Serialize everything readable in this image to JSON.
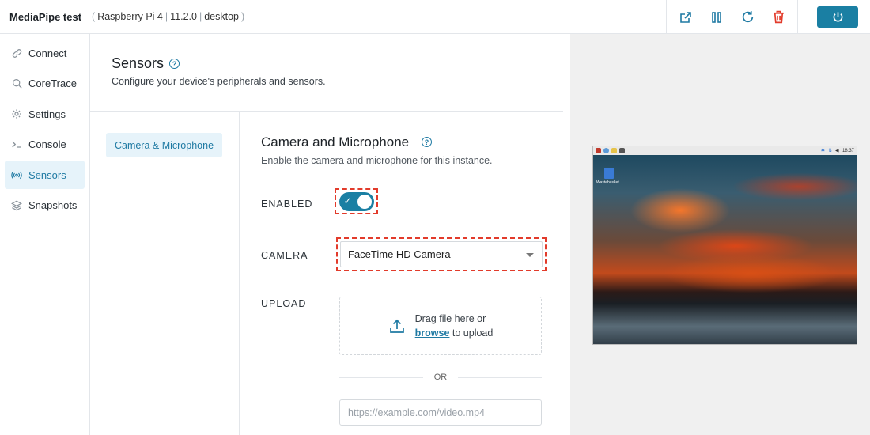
{
  "header": {
    "app_title": "MediaPipe test",
    "device": "Raspberry Pi 4",
    "version": "11.2.0",
    "mode": "desktop"
  },
  "toolbar": {
    "icons": [
      "open-external-icon",
      "pause-icon",
      "refresh-icon",
      "trash-icon"
    ],
    "power_icon": "power-icon",
    "accent": "#1a7fa3",
    "danger": "#e23b2b"
  },
  "sidebar": {
    "items": [
      {
        "label": "Connect",
        "icon": "link-icon"
      },
      {
        "label": "CoreTrace",
        "icon": "search-icon"
      },
      {
        "label": "Settings",
        "icon": "gear-icon"
      },
      {
        "label": "Console",
        "icon": "terminal-icon"
      },
      {
        "label": "Sensors",
        "icon": "sensors-icon",
        "active": true
      },
      {
        "label": "Snapshots",
        "icon": "layers-icon"
      }
    ]
  },
  "page": {
    "title": "Sensors",
    "subtitle": "Configure your device's peripherals and sensors."
  },
  "subnav": {
    "items": [
      {
        "label": "Camera & Microphone",
        "active": true
      }
    ]
  },
  "section": {
    "title": "Camera and Microphone",
    "subtitle": "Enable the camera and microphone for this instance.",
    "enabled_label": "ENABLED",
    "enabled": true,
    "camera_label": "CAMERA",
    "camera_value": "FaceTime HD Camera",
    "upload_label": "UPLOAD",
    "drop_text": "Drag file here or",
    "browse_text": "browse",
    "drop_suffix": "to upload",
    "or_text": "OR",
    "url_placeholder": "https://example.com/video.mp4"
  },
  "preview": {
    "desktop_icon_label": "Wastebasket",
    "clock": "18:37"
  }
}
